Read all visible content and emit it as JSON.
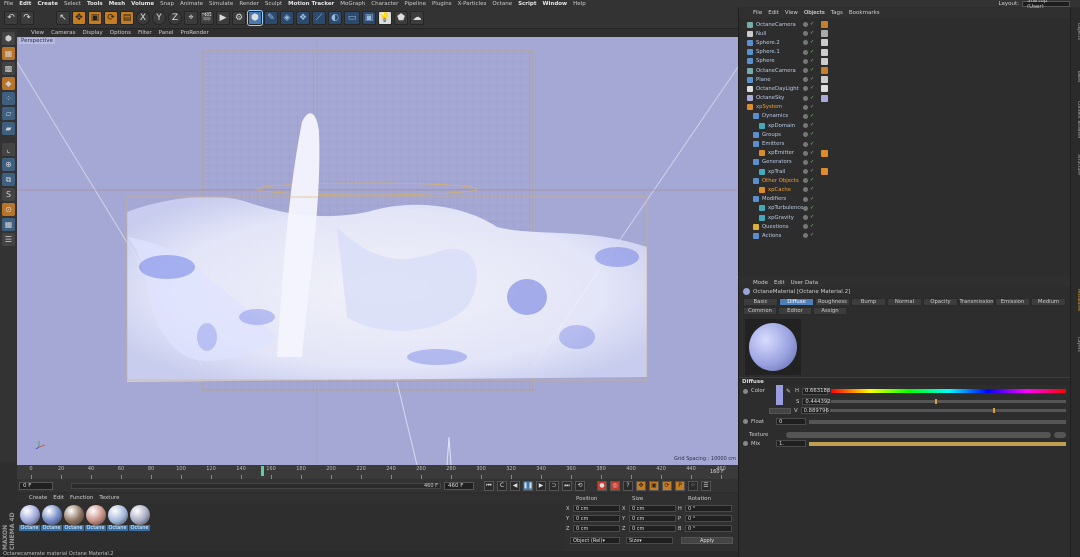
{
  "menu": [
    "File",
    "Edit",
    "Create",
    "Select",
    "Tools",
    "Mesh",
    "Volume",
    "Snap",
    "Animate",
    "Simulate",
    "Render",
    "Sculpt",
    "Motion Tracker",
    "MoGraph",
    "Character",
    "Pipeline",
    "Plugins",
    "X-Particles",
    "Octane",
    "Script",
    "Window",
    "Help"
  ],
  "layout": {
    "label": "Layout:",
    "value": "Startup (User)"
  },
  "viewport": {
    "menu": [
      "View",
      "Cameras",
      "Display",
      "Options",
      "Filter",
      "Panel",
      "ProRender"
    ],
    "label": "Perspective",
    "grid_spacing": "Grid Spacing : 10000 cm"
  },
  "timeline": {
    "ticks": [
      "0",
      "20",
      "40",
      "60",
      "80",
      "100",
      "120",
      "140",
      "160",
      "180",
      "200",
      "220",
      "240",
      "260",
      "280",
      "300",
      "320",
      "340",
      "360",
      "380",
      "400",
      "420",
      "440",
      "460"
    ],
    "end_label": "160 F",
    "current": "160"
  },
  "transport": {
    "start": "0 F",
    "min": "0 F",
    "mid": "460 F",
    "max": "460 F"
  },
  "material_manager": {
    "menu": [
      "Create",
      "Edit",
      "Function",
      "Texture"
    ],
    "materials": [
      {
        "label": "Octane",
        "color": "#9aa4d8"
      },
      {
        "label": "Octane",
        "color": "#6d86c4"
      },
      {
        "label": "Octane",
        "color": "#8a6f5a"
      },
      {
        "label": "Octane",
        "color": "#c48a80"
      },
      {
        "label": "Octane",
        "color": "#9fb3d8"
      },
      {
        "label": "Octane",
        "color": "#a3a8c0"
      }
    ]
  },
  "coordinates": {
    "headers": [
      "Position",
      "Size",
      "Rotation"
    ],
    "rows": [
      {
        "axis": "X",
        "pos": "0 cm",
        "size_axis": "X",
        "size": "0 cm",
        "rot_axis": "H",
        "rot": "0 °"
      },
      {
        "axis": "Y",
        "pos": "0 cm",
        "size_axis": "Y",
        "size": "0 cm",
        "rot_axis": "P",
        "rot": "0 °"
      },
      {
        "axis": "Z",
        "pos": "0 cm",
        "size_axis": "Z",
        "size": "0 cm",
        "rot_axis": "B",
        "rot": "0 °"
      }
    ],
    "mode": "Object (Rel)",
    "size_mode": "Size",
    "apply": "Apply"
  },
  "status": "Octanecamerate material Octane Material.2",
  "object_manager": {
    "menu": [
      "File",
      "Edit",
      "View",
      "Objects",
      "Tags",
      "Bookmarks"
    ],
    "objects": [
      {
        "name": "OctaneCamera",
        "indent": 0,
        "color": "#b9cde8",
        "icon": "#7aa"
      },
      {
        "name": "Null",
        "indent": 0,
        "color": "#b9cde8",
        "icon": "#ccc"
      },
      {
        "name": "Sphere.2",
        "indent": 0,
        "color": "#b9cde8",
        "icon": "#5a8fd0"
      },
      {
        "name": "Sphere.1",
        "indent": 0,
        "color": "#b9cde8",
        "icon": "#5a8fd0"
      },
      {
        "name": "Sphere",
        "indent": 0,
        "color": "#b9cde8",
        "icon": "#5a8fd0"
      },
      {
        "name": "OctaneCamera",
        "indent": 0,
        "color": "#b9cde8",
        "icon": "#7aa"
      },
      {
        "name": "Plane",
        "indent": 0,
        "color": "#b9cde8",
        "icon": "#5a8fd0"
      },
      {
        "name": "OctaneDayLight",
        "indent": 0,
        "color": "#b9cde8",
        "icon": "#ddd"
      },
      {
        "name": "OctaneSky",
        "indent": 0,
        "color": "#b9cde8",
        "icon": "#aad"
      },
      {
        "name": "xpSystem",
        "indent": 0,
        "color": "#f0a23a",
        "icon": "#e08b2a"
      },
      {
        "name": "Dynamics",
        "indent": 1,
        "color": "#b9cde8",
        "icon": "#5a8fd0"
      },
      {
        "name": "xpDomain",
        "indent": 2,
        "color": "#b9cde8",
        "icon": "#4ab"
      },
      {
        "name": "Groups",
        "indent": 1,
        "color": "#b9cde8",
        "icon": "#5a8fd0"
      },
      {
        "name": "Emitters",
        "indent": 1,
        "color": "#b9cde8",
        "icon": "#5a8fd0"
      },
      {
        "name": "xpEmitter",
        "indent": 2,
        "color": "#b9cde8",
        "icon": "#e08b2a"
      },
      {
        "name": "Generators",
        "indent": 1,
        "color": "#b9cde8",
        "icon": "#5a8fd0"
      },
      {
        "name": "xpTrail",
        "indent": 2,
        "color": "#b9cde8",
        "icon": "#4ab"
      },
      {
        "name": "Other Objects",
        "indent": 1,
        "color": "#f0a23a",
        "icon": "#5a8fd0"
      },
      {
        "name": "xpCache",
        "indent": 2,
        "color": "#f0a23a",
        "icon": "#e08b2a"
      },
      {
        "name": "Modifiers",
        "indent": 1,
        "color": "#b9cde8",
        "icon": "#5a8fd0"
      },
      {
        "name": "xpTurbulence",
        "indent": 2,
        "color": "#b9cde8",
        "icon": "#4ab"
      },
      {
        "name": "xpGravity",
        "indent": 2,
        "color": "#b9cde8",
        "icon": "#4ab"
      },
      {
        "name": "Questions",
        "indent": 1,
        "color": "#b9cde8",
        "icon": "#e0b030"
      },
      {
        "name": "Actions",
        "indent": 1,
        "color": "#b9cde8",
        "icon": "#5a8fd0"
      }
    ]
  },
  "attribute_manager": {
    "menu": [
      "Mode",
      "Edit",
      "User Data"
    ],
    "title": "OctaneMaterial [Octane Material.2]",
    "tabs": [
      "Basic",
      "Diffuse",
      "Roughness",
      "Bump",
      "Normal",
      "Opacity",
      "Transmission",
      "Emission",
      "Medium",
      "Common",
      "Editor",
      "Assign"
    ],
    "active_tab": "Diffuse",
    "section": "Diffuse",
    "color_label": "Color",
    "h_label": "H",
    "h_value": "0.663188",
    "s_label": "S",
    "s_value": "0.444392",
    "v_label": "V",
    "v_value": "0.889796",
    "float_label": "Float",
    "float_value": "0",
    "texture_label": "Texture",
    "mix_label": "Mix",
    "mix_value": "1.",
    "swatch": "#9a9ee0"
  },
  "right_tabs": [
    "Objects",
    "Takes",
    "Content Browser",
    "Structure",
    "Attributes",
    "Layers"
  ]
}
